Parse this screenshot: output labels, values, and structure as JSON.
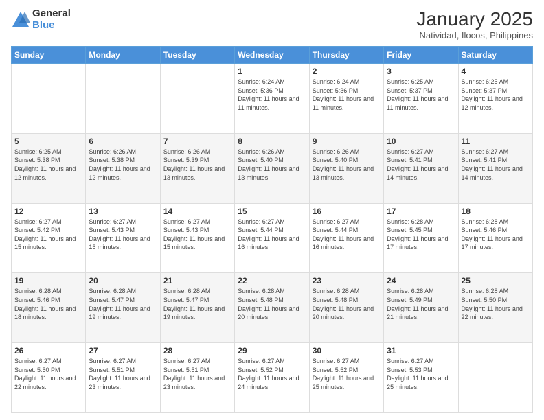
{
  "logo": {
    "general": "General",
    "blue": "Blue"
  },
  "header": {
    "month": "January 2025",
    "location": "Natividad, Ilocos, Philippines"
  },
  "weekdays": [
    "Sunday",
    "Monday",
    "Tuesday",
    "Wednesday",
    "Thursday",
    "Friday",
    "Saturday"
  ],
  "weeks": [
    [
      {
        "day": "",
        "info": ""
      },
      {
        "day": "",
        "info": ""
      },
      {
        "day": "",
        "info": ""
      },
      {
        "day": "1",
        "info": "Sunrise: 6:24 AM\nSunset: 5:36 PM\nDaylight: 11 hours and 11 minutes."
      },
      {
        "day": "2",
        "info": "Sunrise: 6:24 AM\nSunset: 5:36 PM\nDaylight: 11 hours and 11 minutes."
      },
      {
        "day": "3",
        "info": "Sunrise: 6:25 AM\nSunset: 5:37 PM\nDaylight: 11 hours and 11 minutes."
      },
      {
        "day": "4",
        "info": "Sunrise: 6:25 AM\nSunset: 5:37 PM\nDaylight: 11 hours and 12 minutes."
      }
    ],
    [
      {
        "day": "5",
        "info": "Sunrise: 6:25 AM\nSunset: 5:38 PM\nDaylight: 11 hours and 12 minutes."
      },
      {
        "day": "6",
        "info": "Sunrise: 6:26 AM\nSunset: 5:38 PM\nDaylight: 11 hours and 12 minutes."
      },
      {
        "day": "7",
        "info": "Sunrise: 6:26 AM\nSunset: 5:39 PM\nDaylight: 11 hours and 13 minutes."
      },
      {
        "day": "8",
        "info": "Sunrise: 6:26 AM\nSunset: 5:40 PM\nDaylight: 11 hours and 13 minutes."
      },
      {
        "day": "9",
        "info": "Sunrise: 6:26 AM\nSunset: 5:40 PM\nDaylight: 11 hours and 13 minutes."
      },
      {
        "day": "10",
        "info": "Sunrise: 6:27 AM\nSunset: 5:41 PM\nDaylight: 11 hours and 14 minutes."
      },
      {
        "day": "11",
        "info": "Sunrise: 6:27 AM\nSunset: 5:41 PM\nDaylight: 11 hours and 14 minutes."
      }
    ],
    [
      {
        "day": "12",
        "info": "Sunrise: 6:27 AM\nSunset: 5:42 PM\nDaylight: 11 hours and 15 minutes."
      },
      {
        "day": "13",
        "info": "Sunrise: 6:27 AM\nSunset: 5:43 PM\nDaylight: 11 hours and 15 minutes."
      },
      {
        "day": "14",
        "info": "Sunrise: 6:27 AM\nSunset: 5:43 PM\nDaylight: 11 hours and 15 minutes."
      },
      {
        "day": "15",
        "info": "Sunrise: 6:27 AM\nSunset: 5:44 PM\nDaylight: 11 hours and 16 minutes."
      },
      {
        "day": "16",
        "info": "Sunrise: 6:27 AM\nSunset: 5:44 PM\nDaylight: 11 hours and 16 minutes."
      },
      {
        "day": "17",
        "info": "Sunrise: 6:28 AM\nSunset: 5:45 PM\nDaylight: 11 hours and 17 minutes."
      },
      {
        "day": "18",
        "info": "Sunrise: 6:28 AM\nSunset: 5:46 PM\nDaylight: 11 hours and 17 minutes."
      }
    ],
    [
      {
        "day": "19",
        "info": "Sunrise: 6:28 AM\nSunset: 5:46 PM\nDaylight: 11 hours and 18 minutes."
      },
      {
        "day": "20",
        "info": "Sunrise: 6:28 AM\nSunset: 5:47 PM\nDaylight: 11 hours and 19 minutes."
      },
      {
        "day": "21",
        "info": "Sunrise: 6:28 AM\nSunset: 5:47 PM\nDaylight: 11 hours and 19 minutes."
      },
      {
        "day": "22",
        "info": "Sunrise: 6:28 AM\nSunset: 5:48 PM\nDaylight: 11 hours and 20 minutes."
      },
      {
        "day": "23",
        "info": "Sunrise: 6:28 AM\nSunset: 5:48 PM\nDaylight: 11 hours and 20 minutes."
      },
      {
        "day": "24",
        "info": "Sunrise: 6:28 AM\nSunset: 5:49 PM\nDaylight: 11 hours and 21 minutes."
      },
      {
        "day": "25",
        "info": "Sunrise: 6:28 AM\nSunset: 5:50 PM\nDaylight: 11 hours and 22 minutes."
      }
    ],
    [
      {
        "day": "26",
        "info": "Sunrise: 6:27 AM\nSunset: 5:50 PM\nDaylight: 11 hours and 22 minutes."
      },
      {
        "day": "27",
        "info": "Sunrise: 6:27 AM\nSunset: 5:51 PM\nDaylight: 11 hours and 23 minutes."
      },
      {
        "day": "28",
        "info": "Sunrise: 6:27 AM\nSunset: 5:51 PM\nDaylight: 11 hours and 23 minutes."
      },
      {
        "day": "29",
        "info": "Sunrise: 6:27 AM\nSunset: 5:52 PM\nDaylight: 11 hours and 24 minutes."
      },
      {
        "day": "30",
        "info": "Sunrise: 6:27 AM\nSunset: 5:52 PM\nDaylight: 11 hours and 25 minutes."
      },
      {
        "day": "31",
        "info": "Sunrise: 6:27 AM\nSunset: 5:53 PM\nDaylight: 11 hours and 25 minutes."
      },
      {
        "day": "",
        "info": ""
      }
    ]
  ]
}
